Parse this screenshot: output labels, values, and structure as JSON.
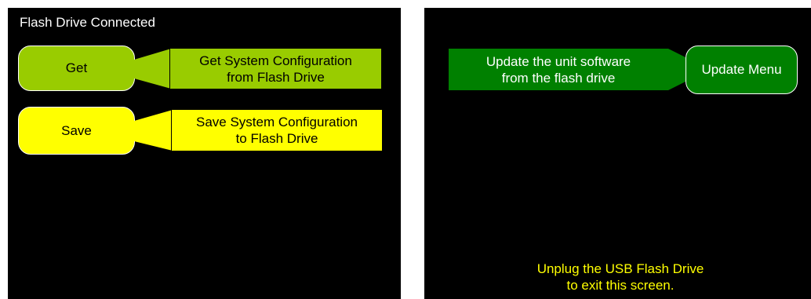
{
  "left_screen": {
    "title": "Flash Drive Connected",
    "get": {
      "button_label": "Get",
      "description": "Get System Configuration\nfrom Flash Drive",
      "color": "#99cc00"
    },
    "save": {
      "button_label": "Save",
      "description": "Save System Configuration\nto Flash Drive",
      "color": "#ffff00"
    }
  },
  "right_screen": {
    "update": {
      "description": "Update the unit software\nfrom the flash drive",
      "button_label": "Update Menu",
      "color": "#008000"
    },
    "message": "Unplug the USB Flash Drive\nto exit this screen.",
    "message_color": "#ffff00"
  }
}
